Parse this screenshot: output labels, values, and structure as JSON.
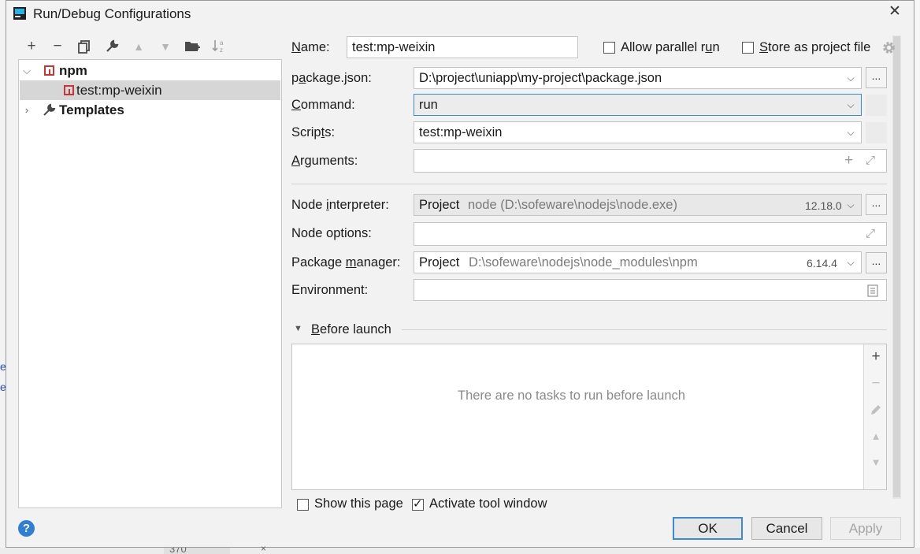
{
  "window": {
    "title": "Run/Debug Configurations"
  },
  "background": {
    "frag1": "e",
    "frag2": "e",
    "frag3": "370",
    "frag4": "×"
  },
  "tree": {
    "items": [
      {
        "label": "npm"
      },
      {
        "label": "test:mp-weixin"
      },
      {
        "label": "Templates"
      }
    ]
  },
  "form": {
    "name_pre": "N",
    "name_label_rest": "ame:",
    "name_value": "test:mp-weixin",
    "allow_parallel_pre": "Allow parallel r",
    "allow_parallel_u": "u",
    "allow_parallel_post": "n",
    "store_project_pre": "",
    "store_project_u": "S",
    "store_project_post": "tore as project file",
    "package_json_pre": "p",
    "package_json_u": "a",
    "package_json_post": "ckage.json:",
    "package_json_value": "D:\\project\\uniapp\\my-project\\package.json",
    "command_u": "C",
    "command_post": "ommand:",
    "command_value": "run",
    "scripts_pre": "Scrip",
    "scripts_u": "t",
    "scripts_post": "s:",
    "scripts_value": "test:mp-weixin",
    "arguments_u": "A",
    "arguments_post": "rguments:",
    "arguments_value": "",
    "node_interp_pre": "Node ",
    "node_interp_u": "i",
    "node_interp_post": "nterpreter:",
    "node_interp_project": "Project",
    "node_interp_path": "node (D:\\sofeware\\nodejs\\node.exe)",
    "node_interp_version": "12.18.0",
    "node_options_label": "Node options:",
    "node_options_value": "",
    "pkg_mgr_pre": "Package ",
    "pkg_mgr_u": "m",
    "pkg_mgr_post": "anager:",
    "pkg_mgr_project": "Project",
    "pkg_mgr_path": "D:\\sofeware\\nodejs\\node_modules\\npm",
    "pkg_mgr_version": "6.14.4",
    "environment_label": "Environment:",
    "environment_value": ""
  },
  "before_launch": {
    "title_u": "B",
    "title_post": "efore launch",
    "empty_text": "There are no tasks to run before launch",
    "show_page_pre": "Show this page",
    "activate_pre": "Activate tool window"
  },
  "buttons": {
    "ok": "OK",
    "cancel": "Cancel",
    "apply": "Apply",
    "help": "?",
    "dots": "..."
  },
  "toolbar": {
    "add": "+",
    "remove": "−",
    "copy": "⧉",
    "edit": "🔧",
    "up": "▲",
    "down": "▼",
    "folder": "📁",
    "sort": "↓"
  },
  "colors": {
    "accent": "#3b8ad6",
    "npm_red": "#cc3333",
    "dialog_bg": "#f2f2f2"
  }
}
